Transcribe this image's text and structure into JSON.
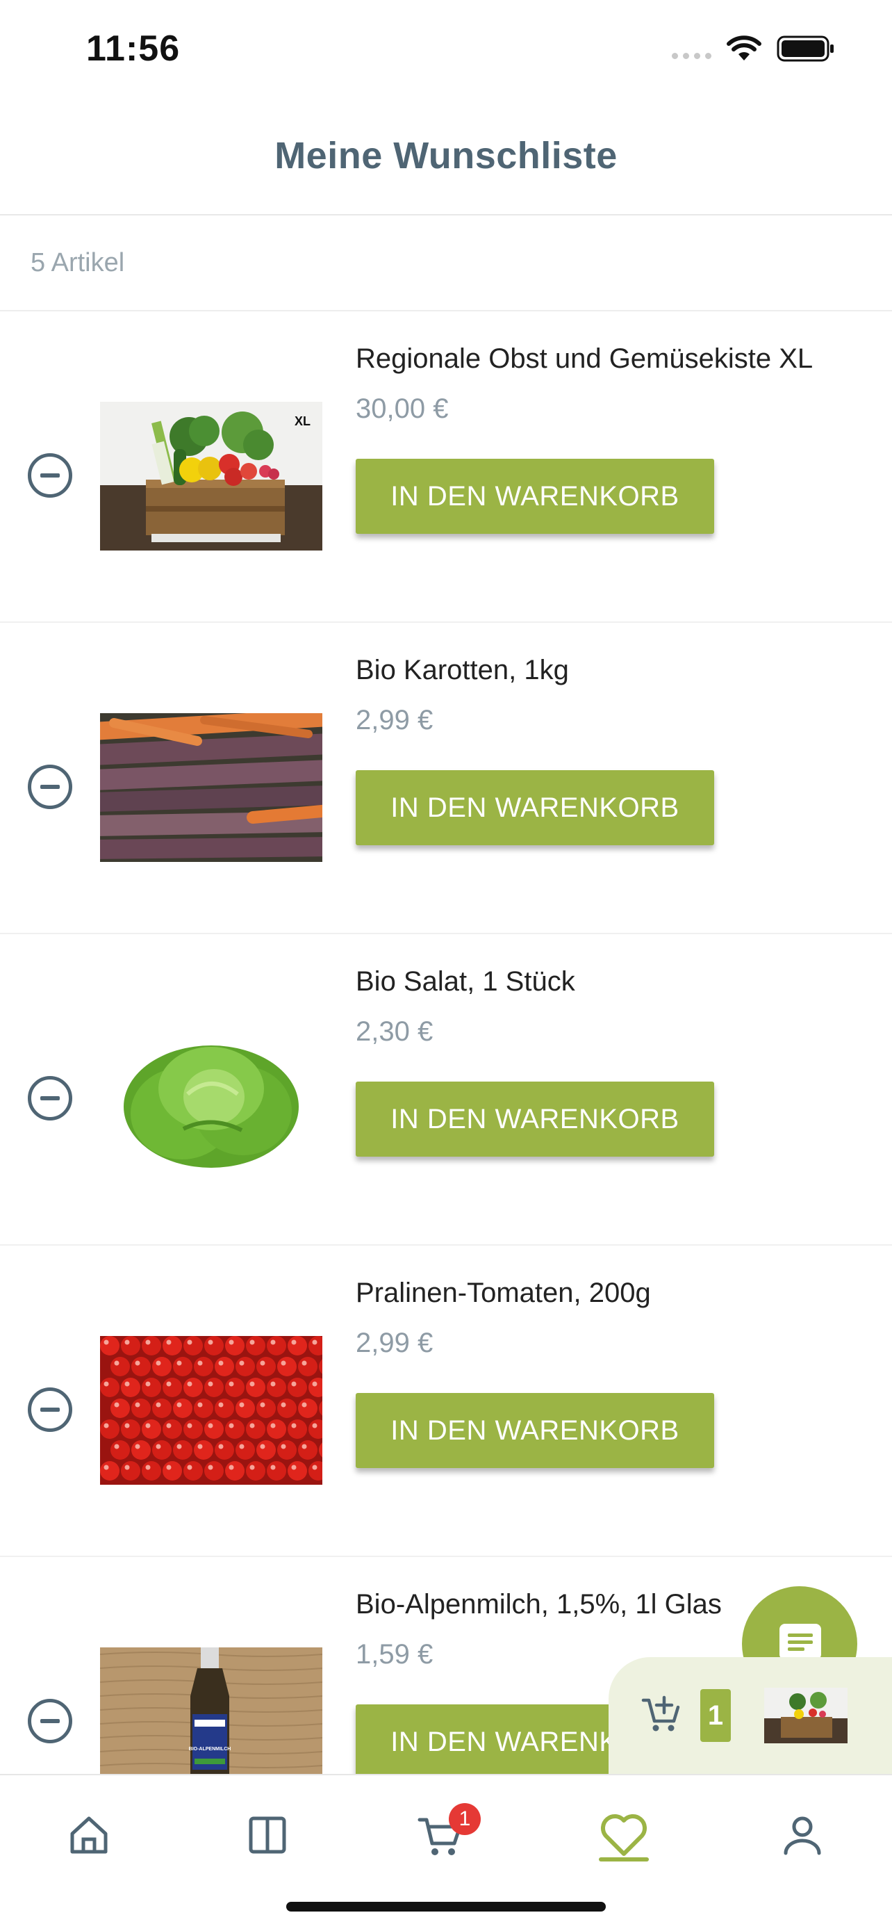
{
  "status_bar": {
    "time": "11:56"
  },
  "header": {
    "title": "Meine Wunschliste"
  },
  "summary": {
    "item_count": "5 Artikel"
  },
  "products": [
    {
      "name": "Regionale Obst und Gemüsekiste XL",
      "price": "30,00 €",
      "button": "IN DEN WARENKORB",
      "image_badge": "XL"
    },
    {
      "name": "Bio Karotten, 1kg",
      "price": "2,99 €",
      "button": "IN DEN WARENKORB"
    },
    {
      "name": "Bio Salat, 1 Stück",
      "price": "2,30 €",
      "button": "IN DEN WARENKORB"
    },
    {
      "name": "Pralinen-Tomaten, 200g",
      "price": "2,99 €",
      "button": "IN DEN WARENKORB"
    },
    {
      "name": "Bio-Alpenmilch, 1,5%, 1l Glas",
      "price": "1,59 €",
      "button": "IN DEN WARENKORB",
      "image_label": "BIO-ALPENMILCH"
    }
  ],
  "mini_cart": {
    "count": "1",
    "icon": "cart-add-icon"
  },
  "chat": {
    "icon": "chat-icon"
  },
  "tab_bar": {
    "items": [
      {
        "icon": "home-icon"
      },
      {
        "icon": "catalog-icon"
      },
      {
        "icon": "cart-icon",
        "badge": "1"
      },
      {
        "icon": "heart-icon",
        "active": true
      },
      {
        "icon": "profile-icon"
      }
    ]
  },
  "colors": {
    "accent": "#9bb445",
    "title": "#4f6574",
    "price": "#8e9ba5",
    "badge": "#e53935"
  }
}
